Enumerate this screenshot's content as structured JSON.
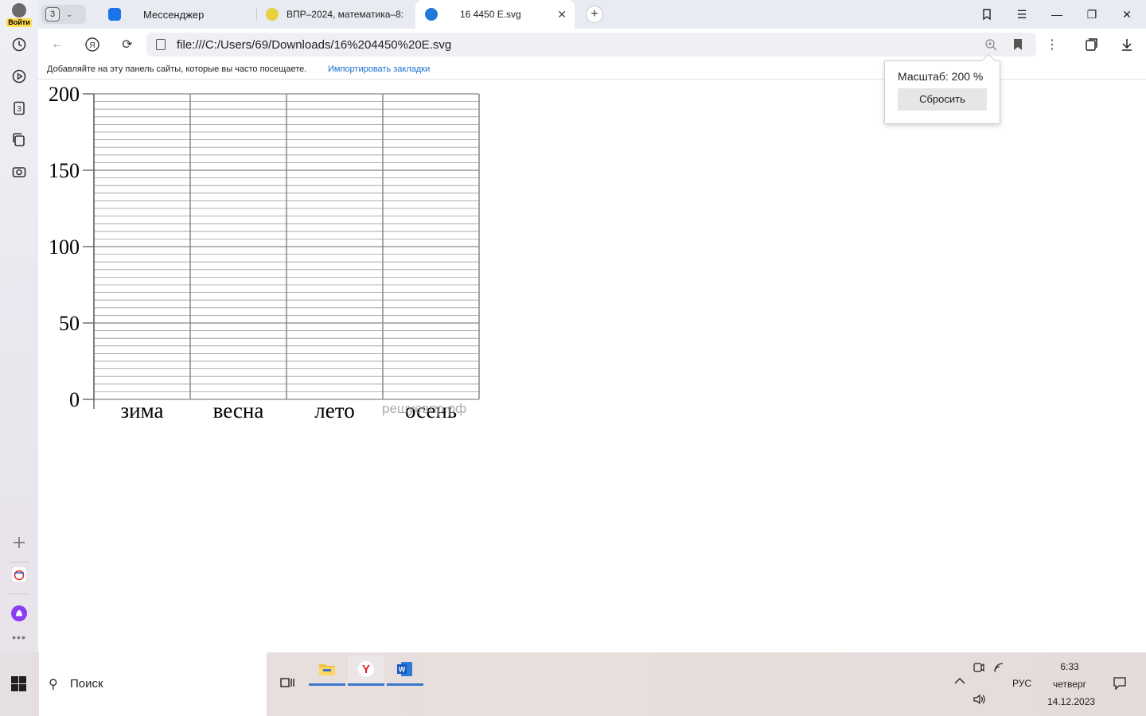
{
  "sidebar": {
    "login_label": "Войти",
    "items": [
      {
        "name": "history-icon"
      },
      {
        "name": "play-icon"
      },
      {
        "name": "collections-icon",
        "badge": "3"
      },
      {
        "name": "notes-icon"
      },
      {
        "name": "screenshot-icon"
      }
    ],
    "bottom": [
      {
        "name": "add-icon"
      },
      {
        "name": "gosuslugi-icon"
      },
      {
        "name": "alice-icon"
      },
      {
        "name": "more-icon"
      }
    ]
  },
  "tabs": {
    "group_count": "3",
    "items": [
      {
        "title": "Мессенджер",
        "icon_color": "#1a73e8"
      },
      {
        "title": "ВПР–2024, математика–8:",
        "icon_color": "#e6d23a"
      },
      {
        "title": "16 4450 E.svg",
        "icon_color": "#1f7ad8",
        "active": true
      }
    ]
  },
  "navbar": {
    "url": "file:///C:/Users/69/Downloads/16%204450%20E.svg"
  },
  "bookmarks_bar": {
    "hint": "Добавляйте на эту панель сайты, которые вы часто посещаете.",
    "import_link": "Импортировать закладки"
  },
  "zoom_popup": {
    "label": "Масштаб: 200 %",
    "reset": "Сбросить"
  },
  "chart_data": {
    "type": "bar",
    "categories": [
      "зима",
      "весна",
      "лето",
      "осень"
    ],
    "values": [],
    "ylim": [
      0,
      200
    ],
    "yticks": [
      "0",
      "50",
      "100",
      "150",
      "200"
    ],
    "grid": true,
    "watermark": "решуевпр.рф"
  },
  "taskbar": {
    "search_label": "Поиск",
    "lang": "РУС",
    "time": "6:33",
    "weekday": "четверг",
    "date": "14.12.2023"
  }
}
